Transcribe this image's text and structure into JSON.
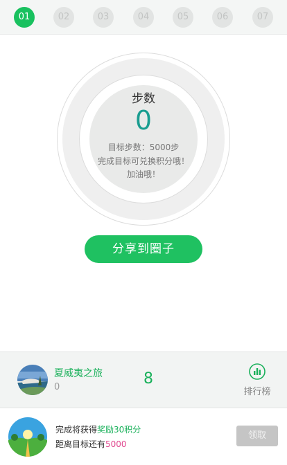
{
  "tabs": [
    {
      "label": "01",
      "active": true
    },
    {
      "label": "02",
      "active": false
    },
    {
      "label": "03",
      "active": false
    },
    {
      "label": "04",
      "active": false
    },
    {
      "label": "05",
      "active": false
    },
    {
      "label": "06",
      "active": false
    },
    {
      "label": "07",
      "active": false
    }
  ],
  "steps": {
    "title": "步数",
    "value": "0",
    "goal_text": "目标步数：5000步",
    "hint1": "完成目标可兑换积分哦！",
    "hint2": "加油哦！"
  },
  "share_button": "分享到圈子",
  "route": {
    "name": "夏威夷之旅",
    "sub_value": "0",
    "center_value": "8",
    "rank_label": "排行榜"
  },
  "reward": {
    "line1_prefix": "完成将获得",
    "line1_highlight": "奖励30积分",
    "line2_prefix": "距离目标还有",
    "line2_highlight": "5000",
    "claim_label": "领取"
  },
  "colors": {
    "accent_green": "#1fc161",
    "steps_teal": "#1a9d90",
    "highlight_pink": "#e0468e",
    "disabled_gray": "#c5c5c5"
  },
  "icons": {
    "rank": "bar-chart-icon"
  }
}
